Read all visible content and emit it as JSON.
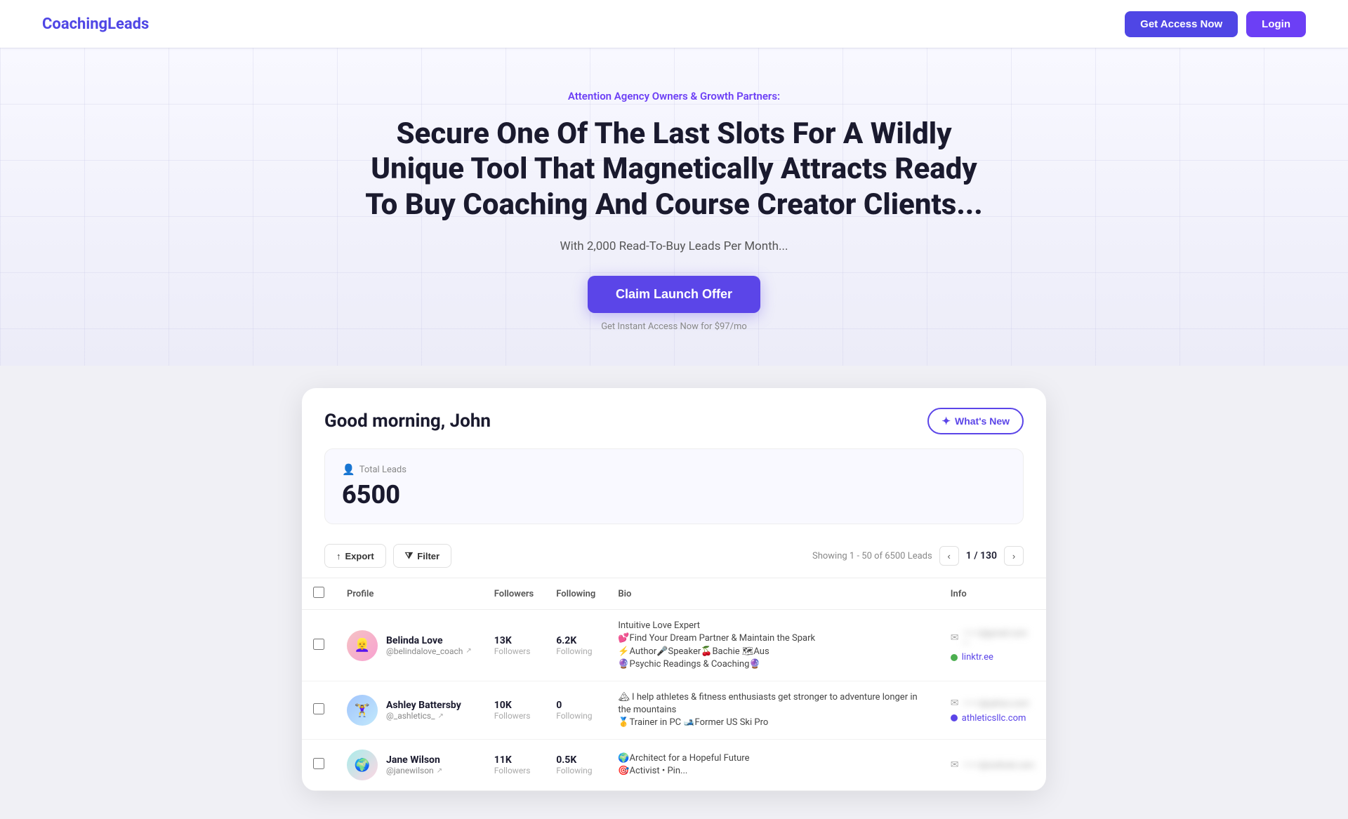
{
  "nav": {
    "logo": "CoachingLeads",
    "get_access_label": "Get Access Now",
    "login_label": "Login"
  },
  "hero": {
    "eyebrow": "Attention Agency Owners & Growth Partners:",
    "title": "Secure One Of The Last Slots For A Wildly Unique Tool That Magnetically Attracts Ready To Buy Coaching And Course Creator Clients...",
    "subtitle": "With 2,000 Read-To-Buy Leads Per Month...",
    "cta_label": "Claim Launch Offer",
    "cta_small": "Get Instant Access Now for $97/mo"
  },
  "dashboard": {
    "greeting": "Good morning, John",
    "whats_new_label": "What's New",
    "total_leads_label": "Total Leads",
    "total_leads_count": "6500",
    "export_label": "Export",
    "filter_label": "Filter",
    "pagination_info": "Showing 1 - 50 of 6500 Leads",
    "page_current": "1 / 130",
    "columns": {
      "profile": "Profile",
      "followers": "Followers",
      "following": "Following",
      "bio": "Bio",
      "info": "Info"
    },
    "leads": [
      {
        "id": 1,
        "name": "Belinda Love",
        "handle": "@belindalove_coach",
        "avatar_emoji": "👱‍♀️",
        "avatar_color": "pink",
        "followers": "13K",
        "following": "6.2K",
        "bio": "Intuitive Love Expert\n💕Find Your Dream Partner & Maintain the Spark\n⚡Author🎤Speaker🍒Bachie 🗺Aus\n🔮Psychic Readings & Coaching🔮",
        "email_blurred": "••••••@gmail.com ••",
        "link_text": "linktr.ee",
        "link_color": "green"
      },
      {
        "id": 2,
        "name": "Ashley Battersby",
        "handle": "@_ashletics_",
        "avatar_emoji": "🏋️‍♀️",
        "avatar_color": "blue",
        "followers": "10K",
        "following": "0",
        "bio": "🏔 I help athletes & fitness enthusiasts get stronger to adventure longer in the mountains\n🥇Trainer in PC 🎿Former US Ski Pro",
        "email_blurred": "••••••@yahoo.com",
        "link_text": "athleticsllc.com",
        "link_color": "blue"
      },
      {
        "id": 3,
        "name": "Jane Wilson",
        "handle": "@janewilson",
        "avatar_emoji": "🌍",
        "avatar_color": "green",
        "followers": "11K",
        "following": "0.5K",
        "bio": "🌍Architect for a Hopeful Future\n🎯Activist • Pin...",
        "email_blurred": "••••••@outlook.com",
        "link_text": "",
        "link_color": ""
      }
    ]
  }
}
